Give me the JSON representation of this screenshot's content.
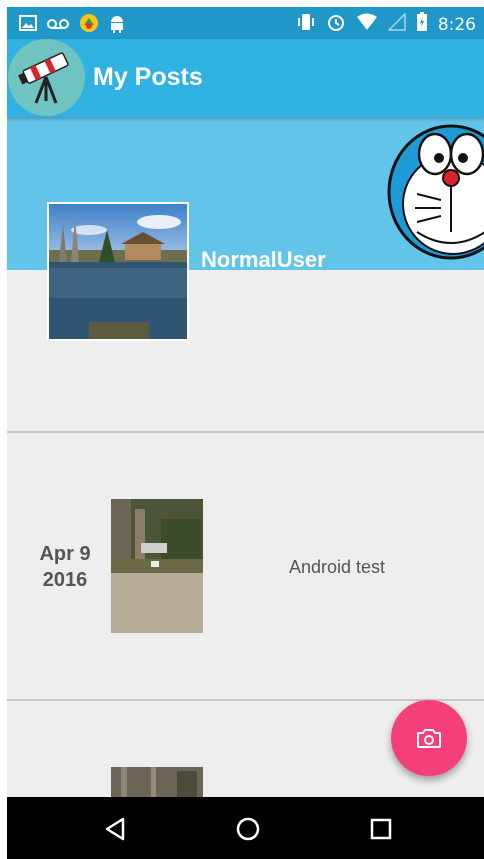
{
  "status_bar": {
    "time": "8:26",
    "left_icons": [
      "image-icon",
      "voicemail-icon",
      "app-badge-icon",
      "android-icon"
    ],
    "right_icons": [
      "vibrate-icon",
      "alarm-icon",
      "wifi-icon",
      "cell-signal-icon",
      "battery-charging-icon"
    ]
  },
  "app_bar": {
    "title": "My Posts",
    "logo_icon": "telescope-icon"
  },
  "profile": {
    "username": "NormalUser",
    "mascot_icon": "doraemon-icon"
  },
  "posts": [
    {
      "date_line1": "Apr 9",
      "date_line2": "2016",
      "caption": "Android test"
    },
    {
      "date_line1": "",
      "date_line2": "",
      "caption": ""
    }
  ],
  "fab": {
    "icon": "camera-icon"
  },
  "nav_bar": {
    "buttons": [
      "back-icon",
      "home-icon",
      "recents-icon"
    ]
  },
  "colors": {
    "status_bar": "#1f98c9",
    "app_bar": "#2fb2e2",
    "banner": "#63c4ea",
    "fab": "#f43f79",
    "background": "#eeeeee"
  }
}
